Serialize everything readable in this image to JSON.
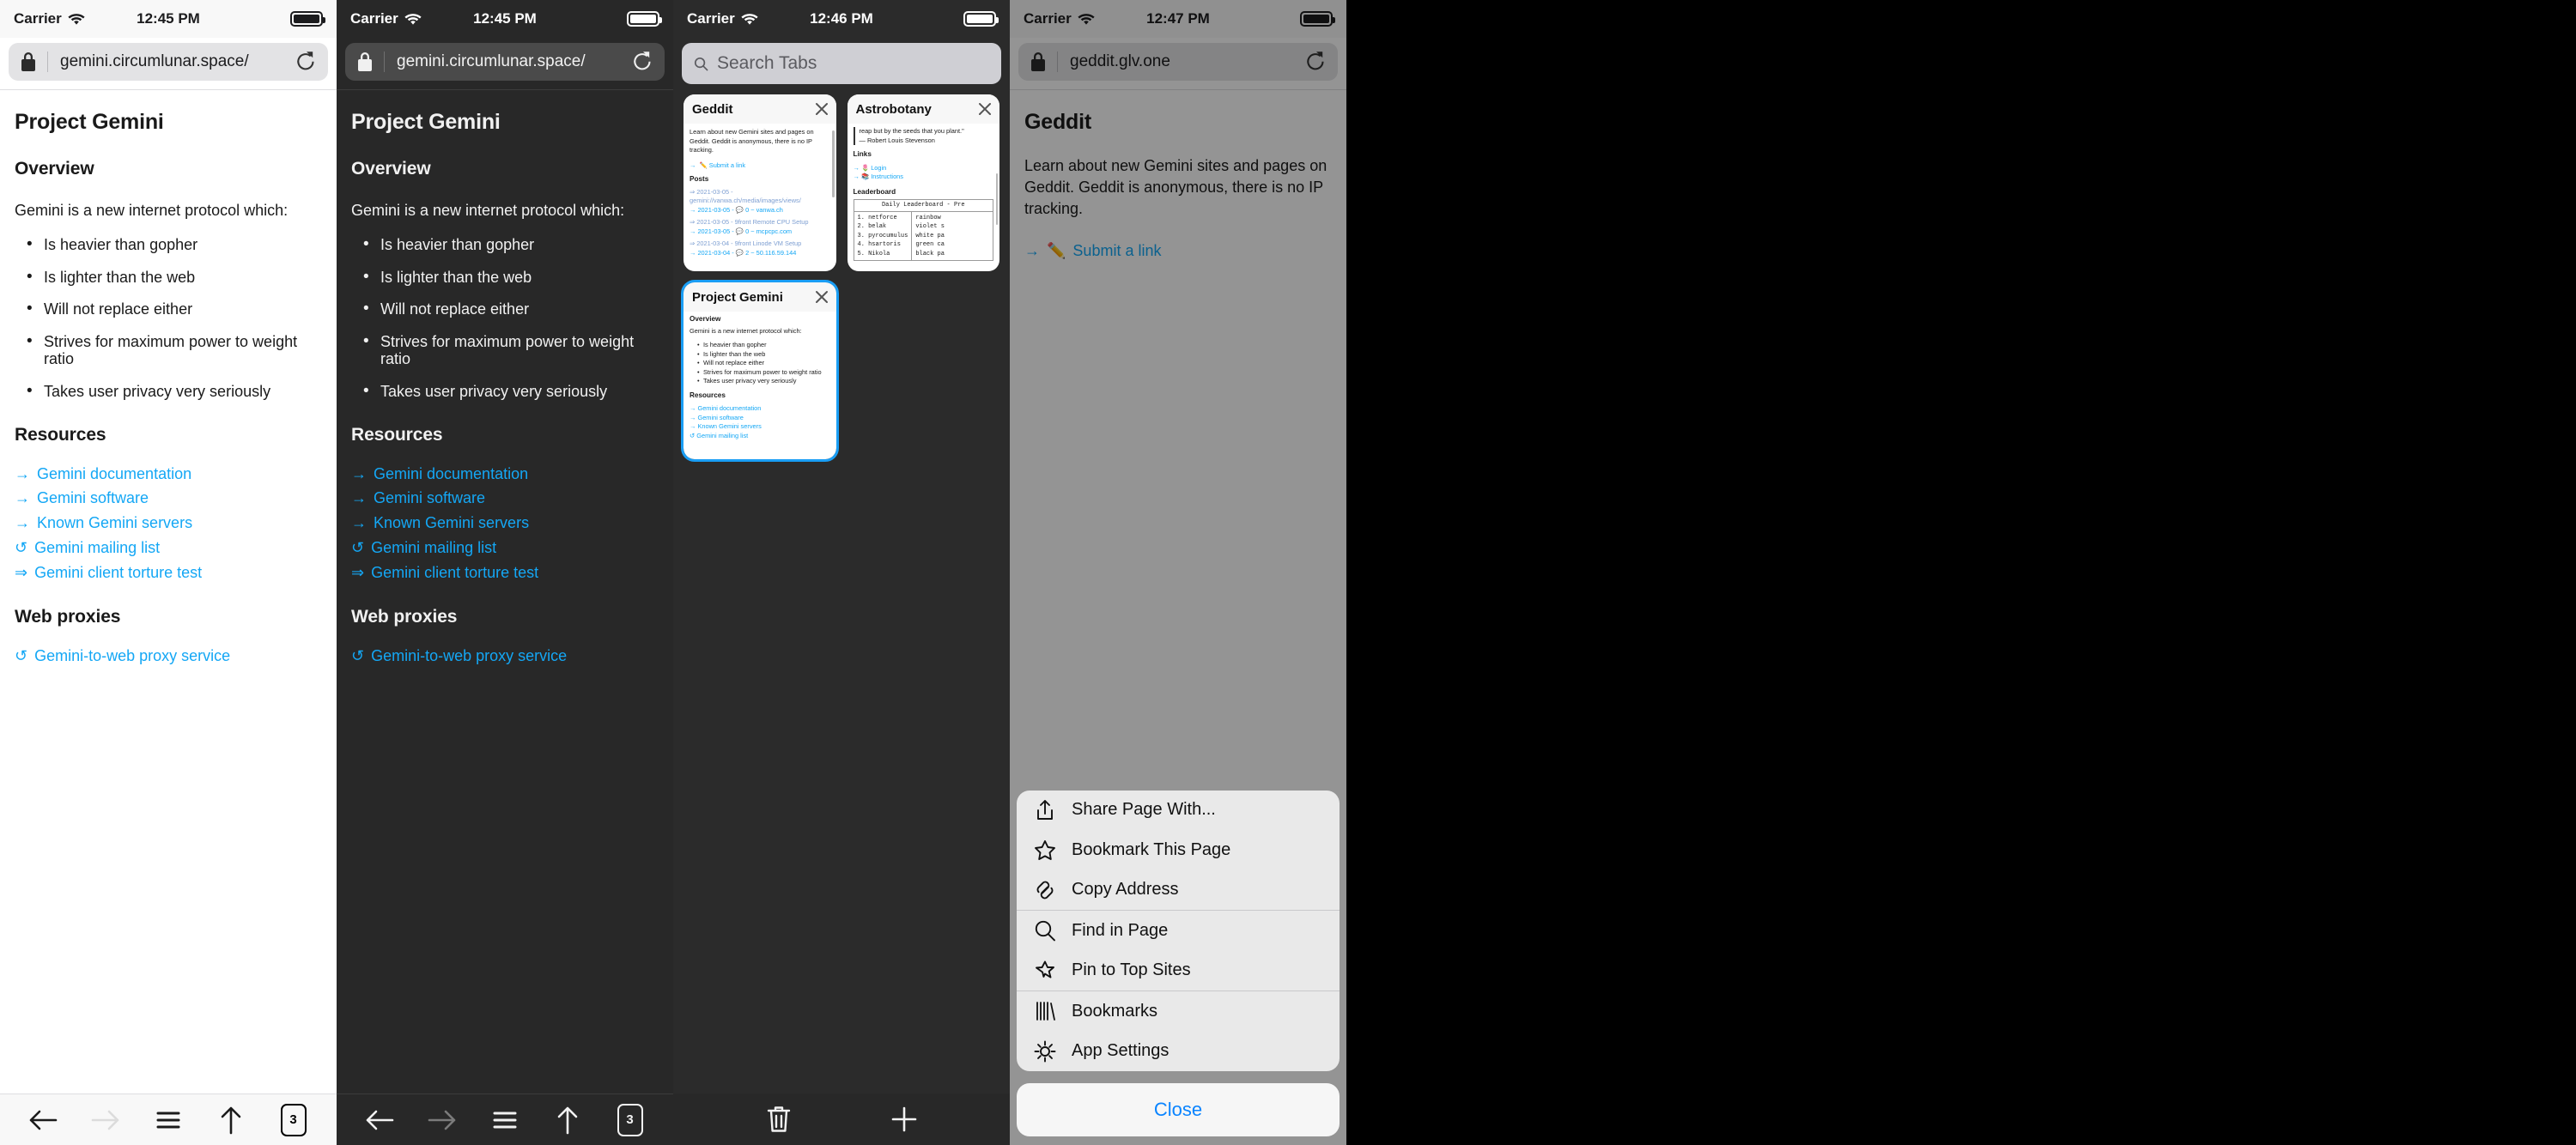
{
  "panels": {
    "p1": {
      "status": {
        "carrier": "Carrier",
        "time": "12:45 PM"
      },
      "url": "gemini.circumlunar.space/",
      "page": {
        "title": "Project Gemini",
        "overview_heading": "Overview",
        "intro": "Gemini is a new internet protocol which:",
        "bullets": [
          "Is heavier than gopher",
          "Is lighter than the web",
          "Will not replace either",
          "Strives for maximum power to weight ratio",
          "Takes user privacy very seriously"
        ],
        "resources_heading": "Resources",
        "resources": [
          {
            "glyph": "→",
            "label": "Gemini documentation"
          },
          {
            "glyph": "→",
            "label": "Gemini software"
          },
          {
            "glyph": "→",
            "label": "Known Gemini servers"
          },
          {
            "glyph": "↺",
            "label": "Gemini mailing list"
          },
          {
            "glyph": "⇒",
            "label": "Gemini client torture test"
          }
        ],
        "proxies_heading": "Web proxies",
        "proxies": [
          {
            "glyph": "↺",
            "label": "Gemini-to-web proxy service"
          }
        ]
      },
      "toolbar": {
        "back": "back-arrow",
        "forward": "forward-arrow",
        "menu": "hamburger",
        "share": "up-arrow",
        "tabs": "3"
      }
    },
    "p2": {
      "status": {
        "carrier": "Carrier",
        "time": "12:45 PM"
      },
      "url": "gemini.circumlunar.space/",
      "toolbar": {
        "tabs": "3"
      }
    },
    "p3": {
      "status": {
        "carrier": "Carrier",
        "time": "12:46 PM"
      },
      "search_placeholder": "Search Tabs",
      "tabs": [
        {
          "title": "Geddit",
          "selected": false,
          "body": {
            "intro": "Learn about new Gemini sites and pages on Geddit. Geddit is anonymous, there is no IP tracking.",
            "submit_link": "Submit a link",
            "submit_glyph": "→",
            "posts_heading": "Posts",
            "posts": [
              {
                "title_glyph": "⇒",
                "title": "2021-03-05 - gemini://vanwa.ch/media/images/views/",
                "meta_glyph": "→",
                "meta": "2021-03-05 - 💬 0 ~ vanwa.ch"
              },
              {
                "title_glyph": "⇒",
                "title": "2021-03-05 - 9front Remote CPU Setup",
                "meta_glyph": "→",
                "meta": "2021-03-05 - 💬 0 ~ mcpcpc.com"
              },
              {
                "title_glyph": "⇒",
                "title": "2021-03-04 - 9front Linode VM Setup",
                "meta_glyph": "→",
                "meta": "2021-03-04 - 💬 2 ~ 50.116.59.144"
              }
            ]
          }
        },
        {
          "title": "Astrobotany",
          "selected": false,
          "body": {
            "quote_line1": "reap but by the seeds that you plant.\"",
            "quote_line2": "— Robert Louis Stevenson",
            "links_heading": "Links",
            "links": [
              {
                "glyph": "→",
                "emoji": "🌷",
                "label": "Login"
              },
              {
                "glyph": "→",
                "emoji": "📚",
                "label": "Instructions"
              }
            ],
            "leaderboard_heading": "Leaderboard",
            "leaderboard_title": "Daily Leaderboard - Pre",
            "leaderboard_rows": [
              {
                "rank": "1.",
                "name": "netforce",
                "desc": "rainbow"
              },
              {
                "rank": "2.",
                "name": "belak",
                "desc": "violet s"
              },
              {
                "rank": "3.",
                "name": "pyrocumulus",
                "desc": "white pa"
              },
              {
                "rank": "4.",
                "name": "hsartoris",
                "desc": "green ca"
              },
              {
                "rank": "5.",
                "name": "Nikola",
                "desc": "black pa"
              }
            ]
          }
        },
        {
          "title": "Project Gemini",
          "selected": true,
          "body": {
            "overview_heading": "Overview",
            "intro": "Gemini is a new internet protocol which:",
            "bullets": [
              "Is heavier than gopher",
              "Is lighter than the web",
              "Will not replace either",
              "Strives for maximum power to weight ratio",
              "Takes user privacy very seriously"
            ],
            "resources_heading": "Resources",
            "resources": [
              {
                "glyph": "→",
                "label": "Gemini documentation"
              },
              {
                "glyph": "→",
                "label": "Gemini software"
              },
              {
                "glyph": "→",
                "label": "Known Gemini servers"
              },
              {
                "glyph": "↺",
                "label": "Gemini mailing list"
              }
            ]
          }
        }
      ],
      "toolbar": {
        "trash": "trash-icon",
        "add": "plus-icon"
      }
    },
    "p4": {
      "status": {
        "carrier": "Carrier",
        "time": "12:47 PM"
      },
      "url": "geddit.glv.one",
      "page": {
        "title": "Geddit",
        "intro": "Learn about new Gemini sites and pages on Geddit. Geddit is anonymous, there is no IP tracking.",
        "submit_glyph": "→",
        "submit_emoji": "✏️",
        "submit_label": "Submit a link"
      },
      "sheet": {
        "groups": [
          [
            {
              "icon": "share-icon",
              "label": "Share Page With..."
            },
            {
              "icon": "star-icon",
              "label": "Bookmark This Page"
            },
            {
              "icon": "link-icon",
              "label": "Copy Address"
            }
          ],
          [
            {
              "icon": "search-icon",
              "label": "Find in Page"
            },
            {
              "icon": "pin-icon",
              "label": "Pin to Top Sites"
            }
          ],
          [
            {
              "icon": "bookmarks-icon",
              "label": "Bookmarks"
            },
            {
              "icon": "gear-icon",
              "label": "App Settings"
            }
          ]
        ],
        "close_label": "Close"
      }
    }
  },
  "colors": {
    "link": "#14a7f5",
    "accent": "#0a84ff",
    "selection": "#1a9ef5"
  }
}
